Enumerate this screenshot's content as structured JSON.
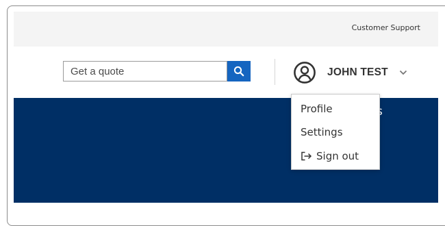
{
  "topbar": {
    "support_label": "Customer Support"
  },
  "header": {
    "search": {
      "placeholder": "Get a quote",
      "button_icon": "search-icon"
    },
    "user": {
      "name": "JOHN TEST",
      "icon": "user-circle-icon",
      "chevron": "chevron-down-icon"
    }
  },
  "hero": {
    "partial_text": "s"
  },
  "user_menu": {
    "items": [
      {
        "label": "Profile"
      },
      {
        "label": "Settings"
      },
      {
        "label": "Sign out",
        "icon": "sign-out-icon"
      }
    ]
  },
  "colors": {
    "accent": "#1565c0",
    "hero_bg": "#002f65",
    "topbar_bg": "#f4f4f4",
    "text": "#333333"
  }
}
